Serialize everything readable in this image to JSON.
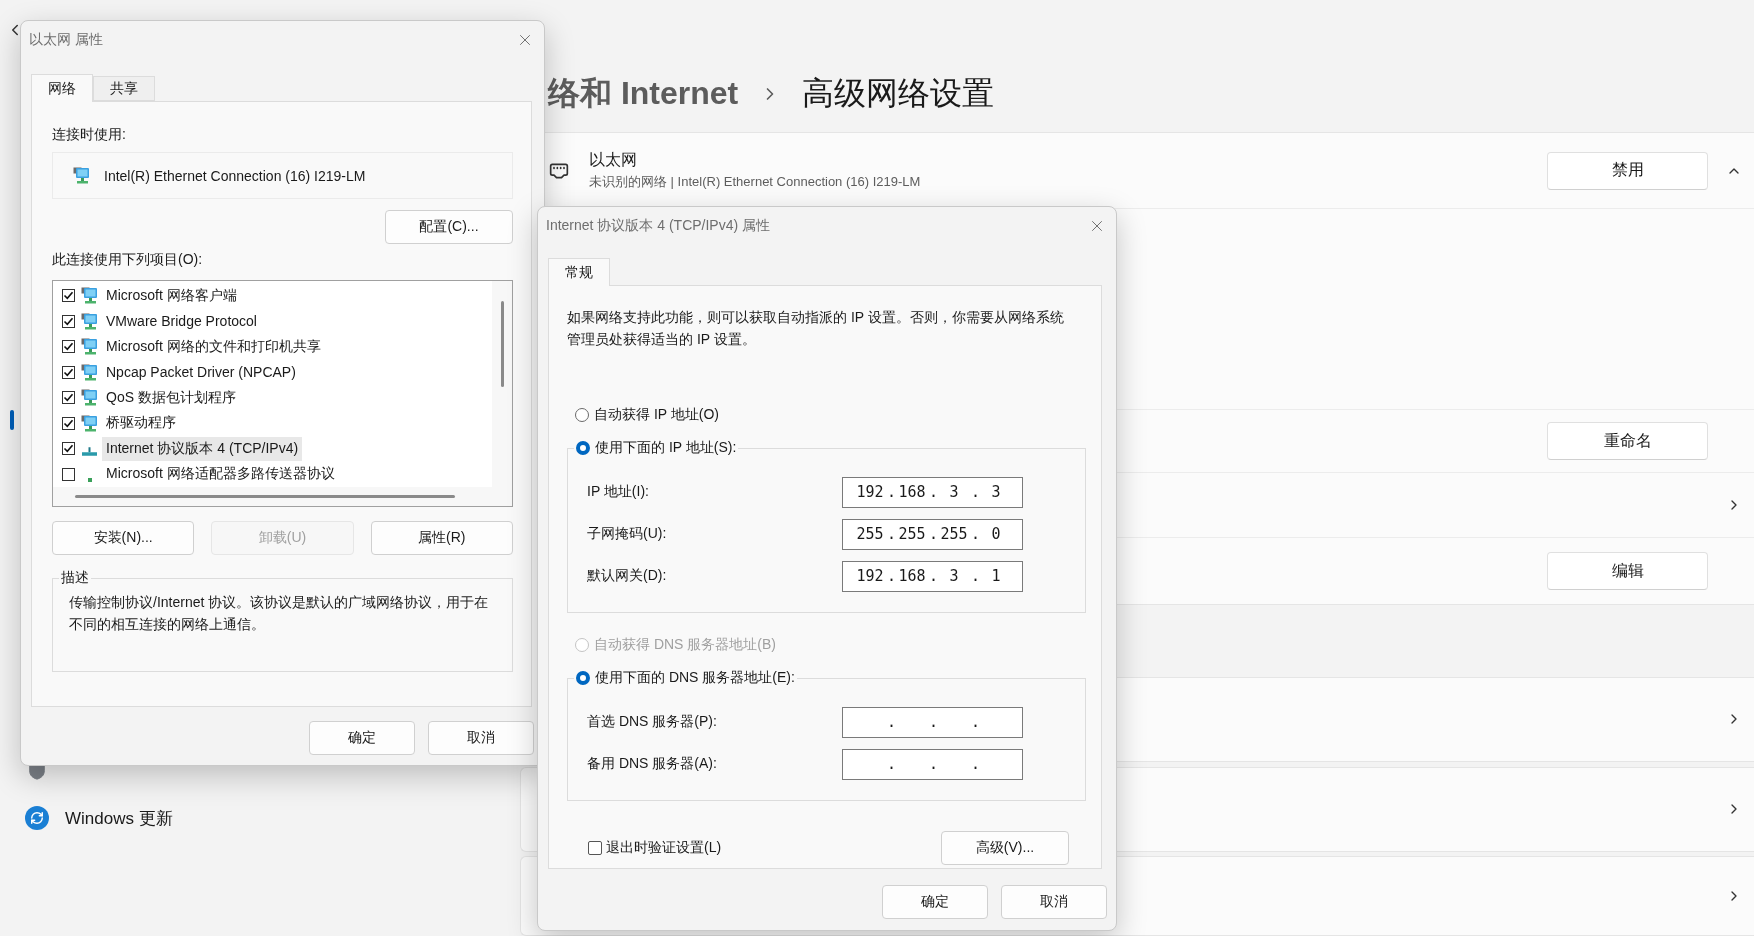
{
  "sidebar": {
    "selection_visible": true,
    "items": [
      {
        "kind": "privacy"
      },
      {
        "kind": "update",
        "label": "Windows 更新"
      }
    ]
  },
  "settings": {
    "breadcrumb_parent": "络和 Internet",
    "breadcrumb_current": "高级网络设置",
    "adapter": {
      "name": "以太网",
      "detail": "未识别的网络 | Intel(R) Ethernet Connection (16) I219-LM",
      "action": "禁用",
      "expanded": true
    },
    "rows": [
      {
        "kind": "button",
        "action": "重命名"
      },
      {
        "kind": "chevron"
      },
      {
        "kind": "button",
        "action": "编辑"
      }
    ],
    "cards": [
      {
        "kind": "chevron"
      },
      {
        "kind": "chevron"
      },
      {
        "kind": "chevron"
      }
    ]
  },
  "ethernet_dialog": {
    "title": "以太网 属性",
    "tabs": [
      {
        "label": "网络",
        "selected": true
      },
      {
        "label": "共享",
        "selected": false
      }
    ],
    "connect_using_label": "连接时使用:",
    "adapter": "Intel(R) Ethernet Connection (16) I219-LM",
    "configure_button": "配置(C)...",
    "items_label": "此连接使用下列项目(O):",
    "items": [
      {
        "label": "Microsoft 网络客户端",
        "checked": true,
        "selected": false,
        "kind": "service"
      },
      {
        "label": "VMware Bridge Protocol",
        "checked": true,
        "selected": false,
        "kind": "service"
      },
      {
        "label": "Microsoft 网络的文件和打印机共享",
        "checked": true,
        "selected": false,
        "kind": "service"
      },
      {
        "label": "Npcap Packet Driver (NPCAP)",
        "checked": true,
        "selected": false,
        "kind": "service"
      },
      {
        "label": "QoS 数据包计划程序",
        "checked": true,
        "selected": false,
        "kind": "service"
      },
      {
        "label": "桥驱动程序",
        "checked": true,
        "selected": false,
        "kind": "service"
      },
      {
        "label": "Internet 协议版本 4 (TCP/IPv4)",
        "checked": true,
        "selected": true,
        "kind": "protocol"
      },
      {
        "label": "Microsoft 网络适配器多路传送器协议",
        "checked": false,
        "selected": false,
        "kind": "small"
      }
    ],
    "buttons": [
      {
        "label": "安装(N)...",
        "disabled": false
      },
      {
        "label": "卸载(U)",
        "disabled": true
      },
      {
        "label": "属性(R)",
        "disabled": false
      }
    ],
    "description_title": "描述",
    "description": "传输控制协议/Internet 协议。该协议是默认的广域网络协议，用于在不同的相互连接的网络上通信。",
    "footer_buttons": [
      "确定",
      "取消"
    ]
  },
  "ipv4_dialog": {
    "title": "Internet 协议版本 4 (TCP/IPv4) 属性",
    "tabs": [
      {
        "label": "常规",
        "selected": true
      }
    ],
    "intro": "如果网络支持此功能，则可以获取自动指派的 IP 设置。否则，你需要从网络系统管理员处获得适当的 IP 设置。",
    "ip_mode": [
      {
        "label": "自动获得 IP 地址(O)",
        "selected": false,
        "disabled": false
      },
      {
        "label": "使用下面的 IP 地址(S):",
        "selected": true,
        "disabled": false
      }
    ],
    "ip_fields": [
      {
        "label": "IP 地址(I):",
        "octets": [
          "192",
          "168",
          "3",
          "3"
        ],
        "dots": [
          ".",
          ".",
          "."
        ]
      },
      {
        "label": "子网掩码(U):",
        "octets": [
          "255",
          "255",
          "255",
          "0"
        ],
        "dots": [
          ".",
          ".",
          "."
        ]
      },
      {
        "label": "默认网关(D):",
        "octets": [
          "192",
          "168",
          "3",
          "1"
        ],
        "dots": [
          ".",
          ".",
          "."
        ]
      }
    ],
    "dns_mode": [
      {
        "label": "自动获得 DNS 服务器地址(B)",
        "selected": false,
        "disabled": true
      },
      {
        "label": "使用下面的 DNS 服务器地址(E):",
        "selected": true,
        "disabled": false
      }
    ],
    "dns_fields": [
      {
        "label": "首选 DNS 服务器(P):",
        "dots": [
          ".",
          ".",
          "."
        ]
      },
      {
        "label": "备用 DNS 服务器(A):",
        "dots": [
          ".",
          ".",
          "."
        ]
      }
    ],
    "validate": {
      "label": "退出时验证设置(L)",
      "checked": false
    },
    "advanced_button": "高级(V)...",
    "footer_buttons": [
      "确定",
      "取消"
    ]
  }
}
